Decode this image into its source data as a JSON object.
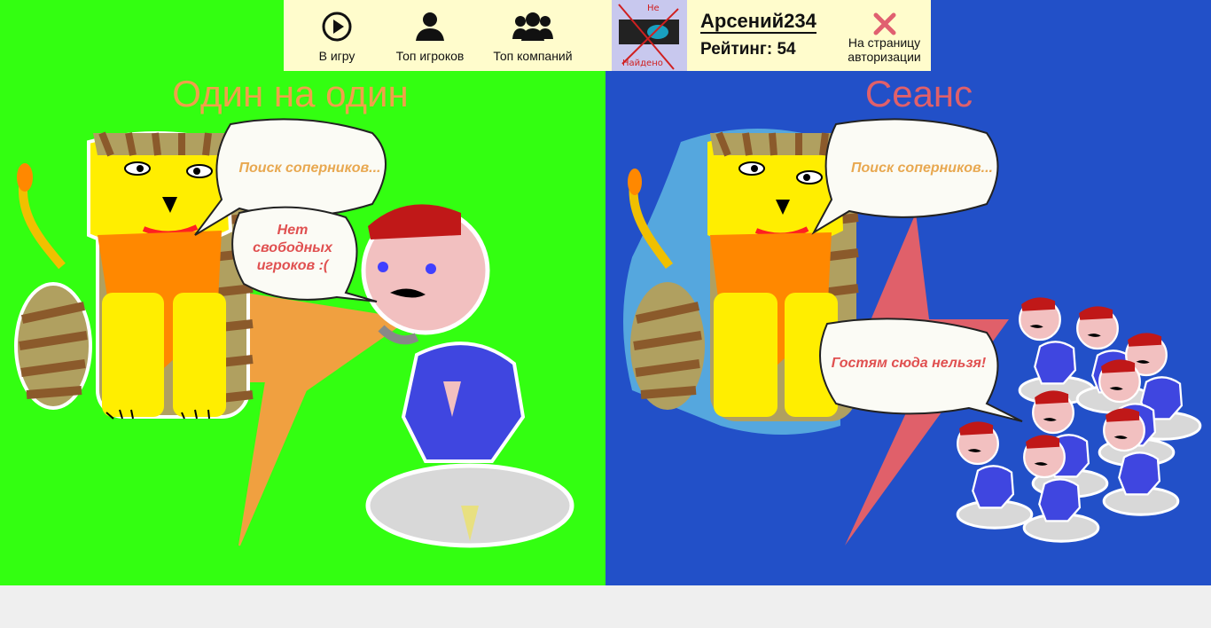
{
  "nav": {
    "play_label": "В игру",
    "top_players_label": "Топ игроков",
    "top_companies_label": "Топ компаний"
  },
  "avatar": {
    "stamp_top": "Не",
    "stamp_bottom": "Найдено"
  },
  "user": {
    "name": "Арсений234",
    "rating_label": "Рейтинг:",
    "rating_value": "54"
  },
  "logout": {
    "label_line1": "На страницу",
    "label_line2": "авторизации"
  },
  "modes": {
    "duel": {
      "title": "Один на один",
      "bubble_search": "Поиск соперников...",
      "bubble_none_1": "Нет",
      "bubble_none_2": "свободных",
      "bubble_none_3": "игроков :("
    },
    "session": {
      "title": "Сеанс",
      "bubble_search": "Поиск соперников...",
      "bubble_guests": "Гостям сюда нельзя!"
    }
  },
  "colors": {
    "left_bg": "#33ff11",
    "right_bg": "#2250c8",
    "topbar_bg": "#fffccc",
    "title_left": "#f0a04a",
    "title_right": "#e0606a"
  }
}
